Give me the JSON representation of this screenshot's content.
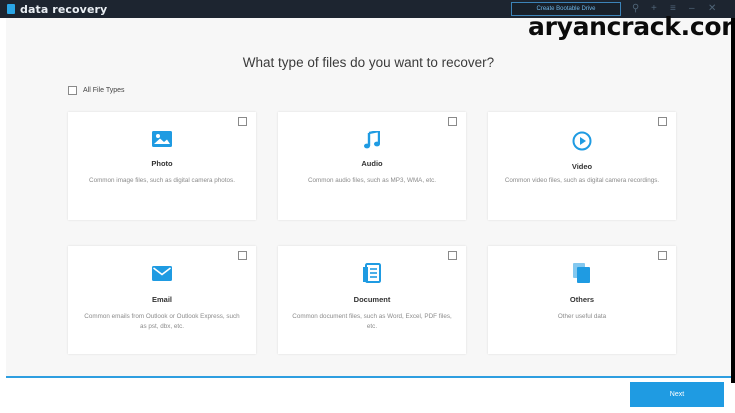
{
  "app": {
    "title": "data recovery"
  },
  "titlebar": {
    "bootable_label": "Create Bootable Drive"
  },
  "watermark": "aryancrack.com",
  "main": {
    "heading": "What type of files do you want to recover?",
    "all_types_label": "All File Types"
  },
  "cards": [
    {
      "title": "Photo",
      "desc": "Common image files, such as digital camera photos.",
      "icon": "image-icon"
    },
    {
      "title": "Audio",
      "desc": "Common audio files, such as MP3, WMA, etc.",
      "icon": "music-note-icon"
    },
    {
      "title": "Video",
      "desc": "Common video files, such as digital camera recordings.",
      "icon": "play-circle-icon"
    },
    {
      "title": "Email",
      "desc": "Common emails from Outlook or Outlook Express, such as pst, dbx, etc.",
      "icon": "envelope-icon"
    },
    {
      "title": "Document",
      "desc": "Common document files, such as Word, Excel, PDF files, etc.",
      "icon": "document-icon"
    },
    {
      "title": "Others",
      "desc": "Other useful data",
      "icon": "files-icon"
    }
  ],
  "footer": {
    "next_label": "Next"
  },
  "colors": {
    "accent": "#1f9be2",
    "titlebar": "#1d2530",
    "background": "#f7f7f7"
  }
}
